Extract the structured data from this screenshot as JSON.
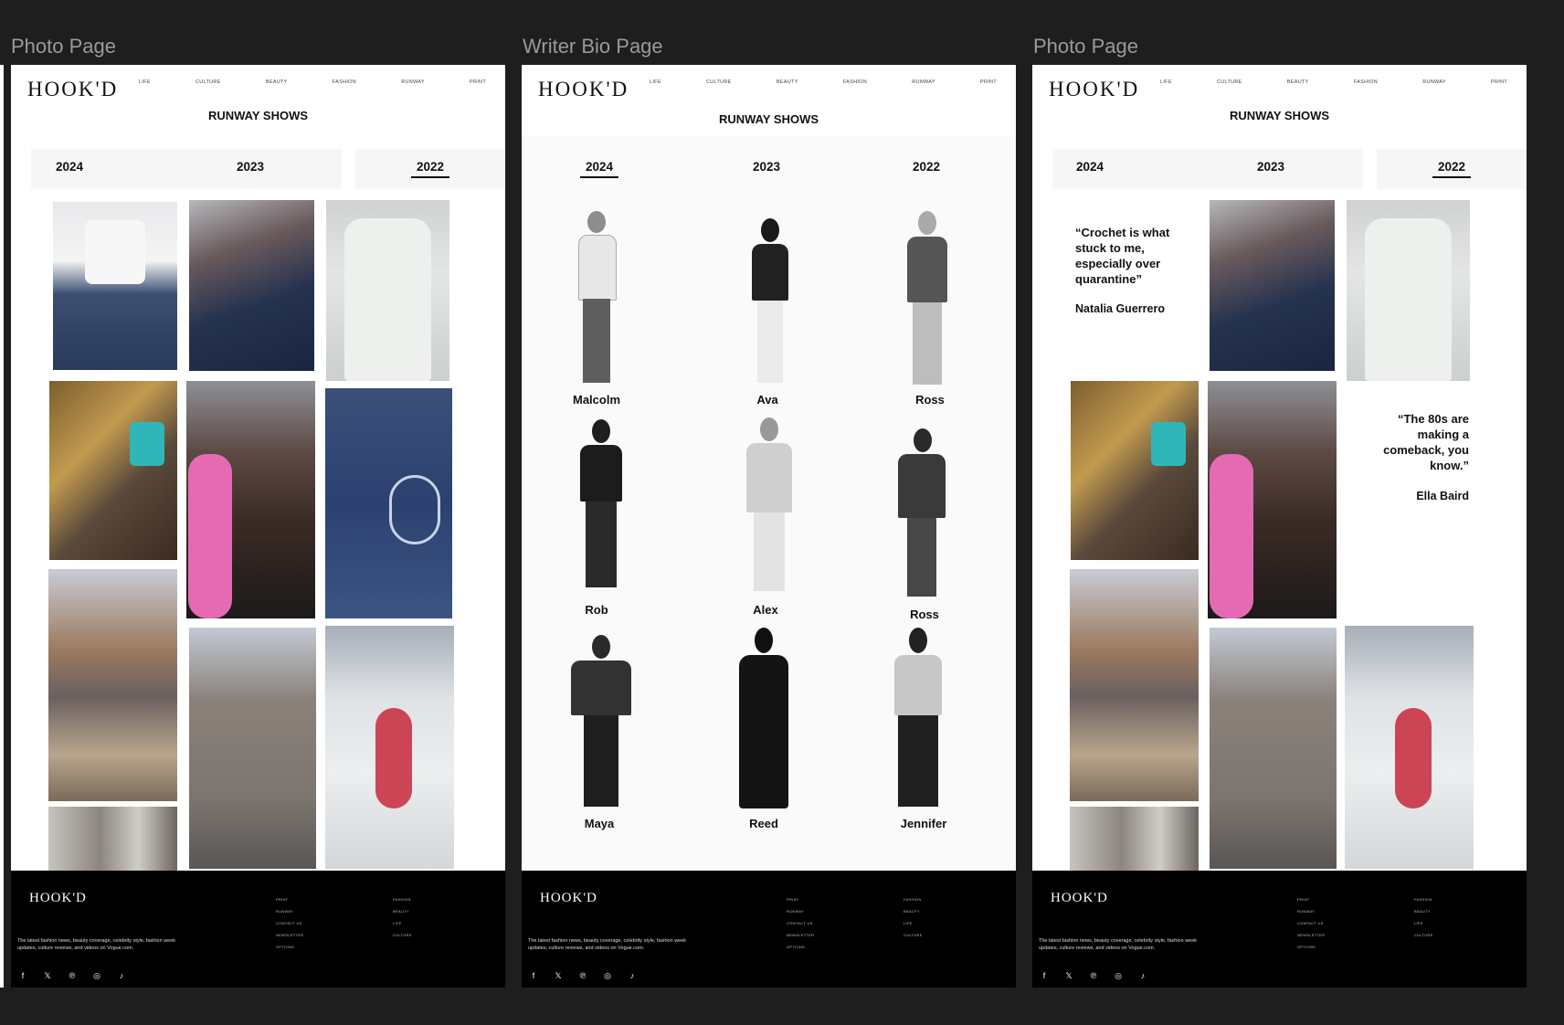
{
  "canvas": {
    "labels": [
      "Photo Page",
      "Writer Bio Page",
      "Photo Page"
    ]
  },
  "brand": {
    "logo": "HOOK'D"
  },
  "nav": [
    "LIFE",
    "CULTURE",
    "BEAUTY",
    "FASHION",
    "RUNWAY",
    "PRINT"
  ],
  "heading": "RUNWAY SHOWS",
  "years": [
    "2024",
    "2023",
    "2022"
  ],
  "photo_page": {
    "active_year": "2022"
  },
  "writer_page": {
    "active_year": "2024",
    "writers": [
      "Malcolm",
      "Ava",
      "Ross",
      "Rob",
      "Alex",
      "Ross",
      "Maya",
      "Reed",
      "Jennifer"
    ]
  },
  "quotes": [
    {
      "text": "“Crochet is what stuck to me, especially over quarantine”",
      "author": "Natalia Guerrero"
    },
    {
      "text": "“The 80s are making a comeback, you know.”",
      "author": "Ella Baird"
    }
  ],
  "footer": {
    "logo": "HOOK'D",
    "description": "The latest fashion news, beauty coverage, celebrity style, fashion week updates, culture reviews, and videos on Vogue.com.",
    "col1": [
      "PRINT",
      "RUNWAY",
      "CONTACT US",
      "NEWSLETTER",
      "OPTIONS"
    ],
    "col2": [
      "FASHION",
      "BEAUTY",
      "LIFE",
      "CULTURE"
    ],
    "social": [
      "facebook-icon",
      "x-icon",
      "pinterest-icon",
      "instagram-icon",
      "tiktok-icon"
    ]
  },
  "colors": {
    "canvas": "#1e1e1e",
    "page": "#ffffff",
    "footer": "#000000",
    "label": "#9a9a9a"
  }
}
